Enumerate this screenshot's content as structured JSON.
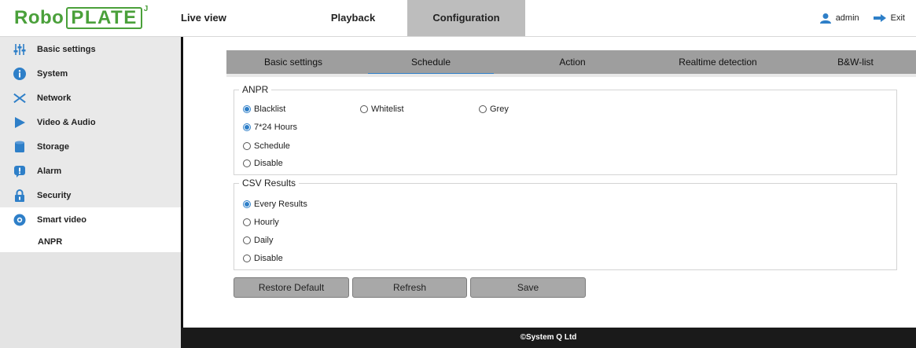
{
  "logo": {
    "part1": "Robo",
    "part2": "PLATE",
    "mark": "J"
  },
  "nav": {
    "live": "Live view",
    "playback": "Playback",
    "config": "Configuration"
  },
  "user": {
    "name": "admin",
    "exit": "Exit"
  },
  "sidebar": {
    "items": [
      {
        "label": "Basic settings",
        "icon": "sliders-icon"
      },
      {
        "label": "System",
        "icon": "info-icon"
      },
      {
        "label": "Network",
        "icon": "network-icon"
      },
      {
        "label": "Video & Audio",
        "icon": "play-icon"
      },
      {
        "label": "Storage",
        "icon": "database-icon"
      },
      {
        "label": "Alarm",
        "icon": "alarm-icon"
      },
      {
        "label": "Security",
        "icon": "lock-icon"
      },
      {
        "label": "Smart video",
        "icon": "smart-video-icon"
      }
    ],
    "sub": "ANPR"
  },
  "tabs": [
    "Basic settings",
    "Schedule",
    "Action",
    "Realtime detection",
    "B&W-list"
  ],
  "anpr": {
    "legend": "ANPR",
    "list_options": [
      "Blacklist",
      "Whitelist",
      "Grey"
    ],
    "schedule_options": [
      "7*24 Hours",
      "Schedule",
      "Disable"
    ]
  },
  "csv": {
    "legend": "CSV Results",
    "options": [
      "Every Results",
      "Hourly",
      "Daily",
      "Disable"
    ]
  },
  "buttons": {
    "restore": "Restore Default",
    "refresh": "Refresh",
    "save": "Save"
  },
  "footer": "©System Q Ltd",
  "colors": {
    "accent": "#2e7fc8",
    "brand": "#4aa03a"
  }
}
